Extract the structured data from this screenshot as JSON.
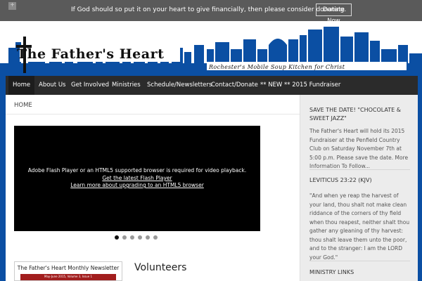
{
  "topbar": {
    "message": "If God should so put it on your heart to give financially, then please consider donating.",
    "donate_label": "Donate Now",
    "plus_glyph": "+",
    "close_glyph": "×"
  },
  "header": {
    "logo_title": "The Father's Heart",
    "logo_subtitle": "Rochester's Mobile Soup Kitchen for Christ",
    "skyline_color": "#0b4fa3"
  },
  "nav": {
    "items": [
      {
        "label": "Home"
      },
      {
        "label": "About Us"
      },
      {
        "label": "Get Involved"
      },
      {
        "label": "Ministries"
      },
      {
        "label": "Schedule/Newsletters"
      },
      {
        "label": "Contact/Donate"
      },
      {
        "label": "** NEW ** 2015 Fundraiser"
      }
    ]
  },
  "main": {
    "breadcrumb": "HOME",
    "video": {
      "line1": "Adobe Flash Player or an HTML5 supported browser is required for video playback.",
      "line2": "Get the latest Flash Player",
      "line3": "Learn more about upgrading to an HTML5 browser"
    },
    "slider_dots": 6,
    "slider_active": 0,
    "newsletter_title": "The Father's Heart Monthly Newsletter",
    "newsletter_bar": "May-June 2015, Volume 3, Issue 1",
    "volunteers_heading": "Volunteers"
  },
  "sidebar": {
    "save_date_title": "SAVE THE DATE! \"CHOCOLATE & SWEET JAZZ\"",
    "save_date_text": "The Father's Heart will hold its 2015 Fundraiser at the Penfield Country Club on Saturday November 7th at 5:00 p.m. Please save the date. More Information To Follow...",
    "leviticus_title": "LEVITICUS 23:22 (KJV)",
    "leviticus_text": "\"And when ye reap the harvest of your land, thou shalt not make clean riddance of the corners of thy field when thou reapest, neither shalt thou gather any gleaning of thy harvest: thou shalt leave them unto the poor, and to the stranger: I am the LORD your God.\"",
    "ministry_links_title": "MINISTRY LINKS"
  },
  "colors": {
    "brand_blue": "#0b4fa3",
    "nav_bg": "#2b2b2b",
    "topbar_bg": "#5a5a5a"
  }
}
